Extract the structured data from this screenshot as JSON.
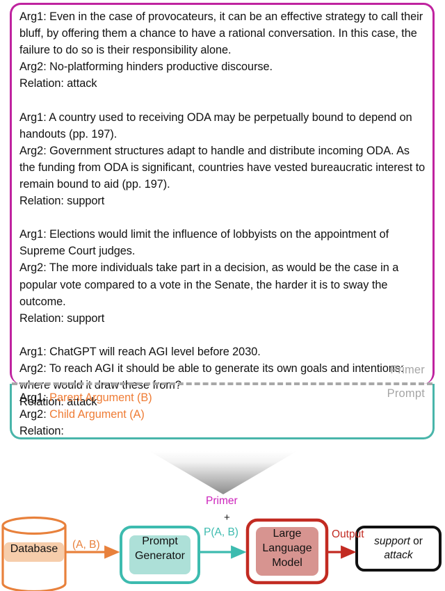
{
  "prompt_card": {
    "primer_label": "Primer",
    "prompt_label": "Prompt",
    "examples": [
      {
        "arg1": "Arg1: Even in the case of provocateurs, it can be an effective strategy to call their bluff, by offering them a chance to have a rational conversation. In this case, the failure to do so is their responsibility alone.",
        "arg2": "Arg2: No-platforming hinders productive discourse.",
        "relation": "Relation: attack"
      },
      {
        "arg1": "Arg1: A country used to receiving ODA may be perpetually bound to depend on handouts (pp. 197).",
        "arg2": "Arg2: Government structures adapt to handle and distribute incoming ODA. As the funding from ODA is significant, countries have vested bureaucratic interest to remain bound to aid (pp. 197).",
        "relation": "Relation: support"
      },
      {
        "arg1": "Arg1: Elections would limit the influence of lobbyists on the appointment of Supreme Court judges.",
        "arg2": "Arg2: The more individuals take part in a decision, as would be the case in a popular vote compared to a vote in the Senate, the harder it is to sway the outcome.",
        "relation": "Relation: support"
      },
      {
        "arg1": "Arg1: ChatGPT will reach AGI level before 2030.",
        "arg2": "Arg2: To reach AGI it should be able to generate its own goals and intentions: where would it draw these from?",
        "relation": "Relation: attack"
      }
    ],
    "query": {
      "arg1_label": "Arg1:",
      "arg1_placeholder": "Parent Argument (B)",
      "arg2_label": "Arg2:",
      "arg2_placeholder": "Child Argument (A)",
      "relation_label": "Relation:"
    }
  },
  "pipeline": {
    "nodes": {
      "database": "Database",
      "prompt_generator_line1": "Prompt",
      "prompt_generator_line2": "Generator",
      "llm_line1": "Large",
      "llm_line2": "Language",
      "llm_line3": "Model",
      "output_a": "support",
      "output_or": " or ",
      "output_b": "attack"
    },
    "edges": {
      "db_to_pg": "(A, B)",
      "primer": "Primer",
      "plus": "+",
      "pab": "P(A, B)",
      "output": "Output"
    }
  },
  "colors": {
    "primer_border": "#bf239f",
    "prompt_border": "#49b5aa",
    "placeholder_orange": "#ef7c35",
    "database_orange": "#e8813c",
    "database_fill": "#f6cdab",
    "teal": "#3dbbaf",
    "teal_fill": "#ade0d8",
    "red": "#c22b22",
    "red_fill": "#d79490",
    "divider_gray": "#a8a8a8",
    "side_label_gray": "#a6a6a6",
    "magenta": "#cc22bb"
  }
}
